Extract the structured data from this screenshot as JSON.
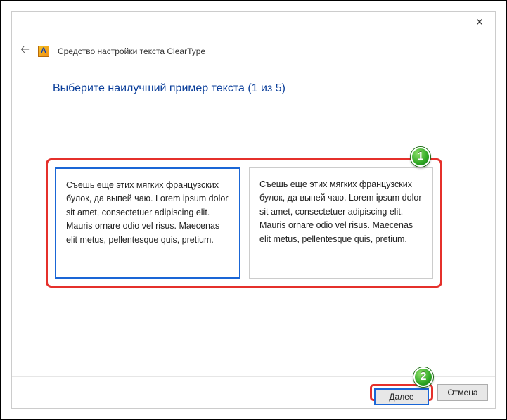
{
  "window": {
    "title": "Средство настройки текста ClearType",
    "icon_letter": "A"
  },
  "heading": "Выберите наилучший пример текста (1 из 5)",
  "samples": {
    "left": "Съешь еще этих мягких французских булок, да выпей чаю. Lorem ipsum dolor sit amet, consectetuer adipiscing elit. Mauris ornare odio vel risus. Maecenas elit metus, pellentesque quis, pretium.",
    "right": "Съешь еще этих мягких французских булок, да выпей чаю. Lorem ipsum dolor sit amet, consectetuer adipiscing elit. Mauris ornare odio vel risus. Maecenas elit metus, pellentesque quis, pretium."
  },
  "buttons": {
    "next": "Далее",
    "cancel": "Отмена"
  },
  "annotations": {
    "badge1": "1",
    "badge2": "2"
  }
}
